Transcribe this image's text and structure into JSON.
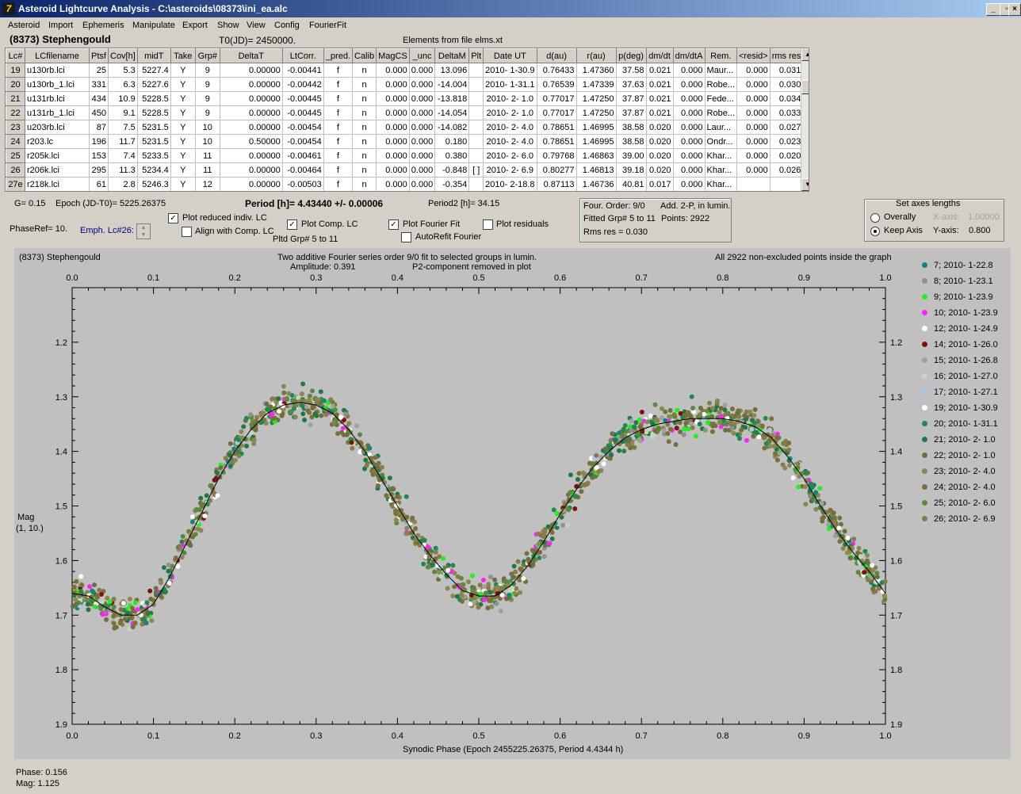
{
  "window": {
    "title": "Asteroid Lightcurve Analysis - C:\\asteroids\\08373\\ini_ea.alc",
    "icon": "astro-app-icon"
  },
  "menu": [
    "Asteroid",
    "Import",
    "Ephemeris",
    "Manipulate",
    "Export",
    "Show",
    "View",
    "Config",
    "FourierFit"
  ],
  "header": {
    "object": "(8373) Stephengould",
    "t0": "T0(JD)= 2450000.",
    "elements": "Elements from file elms.xt"
  },
  "table": {
    "columns": [
      "Lc#",
      "LCfilename",
      "Ptsf",
      "Cov[h]",
      "midT",
      "Take",
      "Grp#",
      "DeltaT",
      "LtCorr.",
      "_pred.",
      "Calib",
      "MagCS",
      "_unc",
      "DeltaM",
      "Plt",
      "Date UT",
      "d(au)",
      "r(au)",
      "p(deg)",
      "dm/dt",
      "dm/dtA",
      "Rem.",
      "<resid>",
      "rms res"
    ],
    "rows": [
      [
        "19",
        "u130rb.lci",
        "25",
        "5.3",
        "5227.4",
        "Y",
        "9",
        "0.00000",
        "-0.00441",
        "f",
        "n",
        "0.000",
        "0.000",
        "13.096",
        "",
        "2010- 1-30.9",
        "0.76433",
        "1.47360",
        "37.58",
        "0.021",
        "0.000",
        "Maur...",
        "0.000",
        "0.031"
      ],
      [
        "20",
        "u130rb_1.lci",
        "331",
        "6.3",
        "5227.6",
        "Y",
        "9",
        "0.00000",
        "-0.00442",
        "f",
        "n",
        "0.000",
        "0.000",
        "-14.004",
        "",
        "2010- 1-31.1",
        "0.76539",
        "1.47339",
        "37.63",
        "0.021",
        "0.000",
        "Robe...",
        "0.000",
        "0.030"
      ],
      [
        "21",
        "u131rb.lci",
        "434",
        "10.9",
        "5228.5",
        "Y",
        "9",
        "0.00000",
        "-0.00445",
        "f",
        "n",
        "0.000",
        "0.000",
        "-13.818",
        "",
        "2010- 2- 1.0",
        "0.77017",
        "1.47250",
        "37.87",
        "0.021",
        "0.000",
        "Fede...",
        "0.000",
        "0.034"
      ],
      [
        "22",
        "u131rb_1.lci",
        "450",
        "9.1",
        "5228.5",
        "Y",
        "9",
        "0.00000",
        "-0.00445",
        "f",
        "n",
        "0.000",
        "0.000",
        "-14.054",
        "",
        "2010- 2- 1.0",
        "0.77017",
        "1.47250",
        "37.87",
        "0.021",
        "0.000",
        "Robe...",
        "0.000",
        "0.033"
      ],
      [
        "23",
        "u203rb.lci",
        "87",
        "7.5",
        "5231.5",
        "Y",
        "10",
        "0.00000",
        "-0.00454",
        "f",
        "n",
        "0.000",
        "0.000",
        "-14.082",
        "",
        "2010- 2- 4.0",
        "0.78651",
        "1.46995",
        "38.58",
        "0.020",
        "0.000",
        "Laur...",
        "0.000",
        "0.027"
      ],
      [
        "24",
        "r203.lc",
        "196",
        "11.7",
        "5231.5",
        "Y",
        "10",
        "0.50000",
        "-0.00454",
        "f",
        "n",
        "0.000",
        "0.000",
        "0.180",
        "",
        "2010- 2- 4.0",
        "0.78651",
        "1.46995",
        "38.58",
        "0.020",
        "0.000",
        "Ondr...",
        "0.000",
        "0.023"
      ],
      [
        "25",
        "r205k.lci",
        "153",
        "7.4",
        "5233.5",
        "Y",
        "11",
        "0.00000",
        "-0.00461",
        "f",
        "n",
        "0.000",
        "0.000",
        "0.380",
        "",
        "2010- 2- 6.0",
        "0.79768",
        "1.46863",
        "39.00",
        "0.020",
        "0.000",
        "Khar...",
        "0.000",
        "0.020"
      ],
      [
        "26",
        "r206k.lci",
        "295",
        "11.3",
        "5234.4",
        "Y",
        "11",
        "0.00000",
        "-0.00464",
        "f",
        "n",
        "0.000",
        "0.000",
        "-0.848",
        "[ ]",
        "2010- 2- 6.9",
        "0.80277",
        "1.46813",
        "39.18",
        "0.020",
        "0.000",
        "Khar...",
        "0.000",
        "0.026"
      ],
      [
        "27e",
        "r218k.lci",
        "61",
        "2.8",
        "5246.3",
        "Y",
        "12",
        "0.00000",
        "-0.00503",
        "f",
        "n",
        "0.000",
        "0.000",
        "-0.354",
        "",
        "2010- 2-18.8",
        "0.87113",
        "1.46736",
        "40.81",
        "0.017",
        "0.000",
        "Khar...",
        "",
        ""
      ]
    ]
  },
  "controls": {
    "g": "G= 0.15",
    "epoch": "Epoch (JD-T0)= 5225.26375",
    "period": "Period [h]= 4.43440 +/- 0.00006",
    "period2": "Period2 [h]= 34.15",
    "phaseref": "PhaseRef= 10.",
    "emph": "Emph. Lc#26:",
    "plot_reduced": "Plot reduced indiv. LC",
    "align_comp": "Align with Comp. LC",
    "plot_comp": "Plot Comp. LC",
    "pltd_grp": "Pltd Grp#  5  to  11",
    "plot_fourier": "Plot Fourier Fit",
    "autorefit": "AutoRefit Fourier",
    "plot_residuals": "Plot residuals",
    "fourier_order": "Four. Order:  9/0",
    "add": "Add. 2-P, in lumin.",
    "fitted": "Fitted Grp# 5 to 11",
    "points": "Points: 2922",
    "rms": "Rms res     = 0.030",
    "axes_title": "Set axes lengths",
    "overally": "Overally",
    "keep_axis": "Keep Axis",
    "xaxis_label": "X-axis:",
    "xaxis_val": "1.00000",
    "yaxis_label": "Y-axis:",
    "yaxis_val": "0.800"
  },
  "plot": {
    "obj": "(8373) Stephengould",
    "desc1": "Two additive Fourier series order 9/0 fit to selected groups in lumin.",
    "desc2_amp": "Amplitude: 0.391",
    "desc2_p2": "P2-component removed in plot",
    "allpts": "All 2922 non-excluded points inside the graph",
    "ylabel1": "Mag",
    "ylabel2": "(1, 10.)",
    "xlabel": "Synodic Phase (Epoch 2455225.26375, Period 4.4344 h)"
  },
  "chart_data": {
    "type": "scatter",
    "xlim": [
      0.0,
      1.0
    ],
    "ylim": [
      1.9,
      1.1
    ],
    "x_ticks": [
      "0.0",
      "0.1",
      "0.2",
      "0.3",
      "0.4",
      "0.5",
      "0.6",
      "0.7",
      "0.8",
      "0.9",
      "1.0"
    ],
    "y_ticks": [
      "1.2",
      "1.3",
      "1.4",
      "1.5",
      "1.6",
      "1.7",
      "1.8",
      "1.9"
    ],
    "fit_curve": {
      "x": [
        0.0,
        0.02,
        0.04,
        0.06,
        0.08,
        0.1,
        0.12,
        0.14,
        0.16,
        0.18,
        0.2,
        0.22,
        0.24,
        0.26,
        0.28,
        0.3,
        0.32,
        0.34,
        0.36,
        0.38,
        0.4,
        0.42,
        0.44,
        0.46,
        0.48,
        0.5,
        0.52,
        0.54,
        0.56,
        0.58,
        0.6,
        0.62,
        0.64,
        0.66,
        0.68,
        0.7,
        0.72,
        0.74,
        0.76,
        0.78,
        0.8,
        0.82,
        0.84,
        0.86,
        0.88,
        0.9,
        0.92,
        0.94,
        0.96,
        0.98,
        1.0
      ],
      "y": [
        1.66,
        1.665,
        1.685,
        1.7,
        1.7,
        1.68,
        1.63,
        1.57,
        1.51,
        1.45,
        1.4,
        1.36,
        1.33,
        1.315,
        1.31,
        1.315,
        1.33,
        1.36,
        1.4,
        1.45,
        1.5,
        1.55,
        1.59,
        1.625,
        1.655,
        1.665,
        1.665,
        1.645,
        1.61,
        1.565,
        1.515,
        1.47,
        1.43,
        1.4,
        1.375,
        1.36,
        1.35,
        1.345,
        1.34,
        1.34,
        1.34,
        1.345,
        1.355,
        1.375,
        1.41,
        1.45,
        1.5,
        1.545,
        1.585,
        1.62,
        1.66
      ]
    },
    "series": [
      {
        "name": "7; 2010- 1-22.8",
        "color": "#1a8080"
      },
      {
        "name": "8; 2010- 1-23.1",
        "color": "#909090"
      },
      {
        "name": "9; 2010- 1-23.9",
        "color": "#22ee22"
      },
      {
        "name": "10; 2010- 1-23.9",
        "color": "#ff22ff"
      },
      {
        "name": "12; 2010- 1-24.9",
        "color": "#ffffff"
      },
      {
        "name": "14; 2010- 1-26.0",
        "color": "#801010"
      },
      {
        "name": "15; 2010- 1-26.8",
        "color": "#a0a0a0"
      },
      {
        "name": "16; 2010- 1-27.0",
        "color": "#c0d8c0"
      },
      {
        "name": "17; 2010- 1-27.1",
        "color": "#a8c8e8"
      },
      {
        "name": "19; 2010- 1-30.9",
        "color": "#ffffff"
      },
      {
        "name": "20; 2010- 1-31.1",
        "color": "#208850"
      },
      {
        "name": "21; 2010- 2- 1.0",
        "color": "#207848"
      },
      {
        "name": "22; 2010- 2- 1.0",
        "color": "#6e6e40"
      },
      {
        "name": "23; 2010- 2- 4.0",
        "color": "#888850"
      },
      {
        "name": "24; 2010- 2- 4.0",
        "color": "#7a7038"
      },
      {
        "name": "25; 2010- 2- 6.0",
        "color": "#5a8a40"
      },
      {
        "name": "26; 2010- 2- 6.9",
        "color": "#8a7a48"
      }
    ]
  },
  "status": {
    "phase": "Phase:  0.156",
    "mag": "Mag:    1.125"
  }
}
